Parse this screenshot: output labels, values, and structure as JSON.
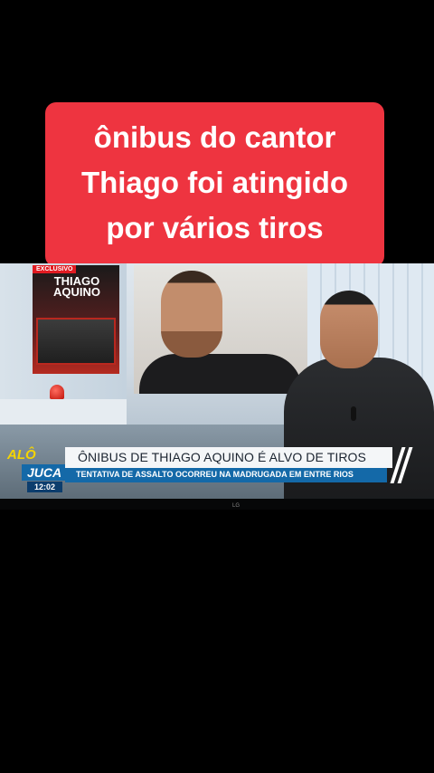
{
  "caption": {
    "line1": "ônibus do cantor",
    "line2": "Thiago foi atingido",
    "line3": "por vários tiros"
  },
  "broadcast": {
    "exclusive_tag": "EXCLUSIVO",
    "panel_name": "THIAGO AQUINO",
    "show": {
      "alo": "ALÔ",
      "juca": "JUCA",
      "time": "12:02"
    },
    "headline": "ÔNIBUS DE THIAGO AQUINO É ALVO DE TIROS",
    "subheadline": "TENTATIVA DE ASSALTO OCORREU NA MADRUGADA EM ENTRE RIOS",
    "tv_brand": "LG"
  },
  "colors": {
    "caption_bg": "#ee3440",
    "headline_bar": "#f4f6f8",
    "sub_bar": "#1469a8"
  }
}
